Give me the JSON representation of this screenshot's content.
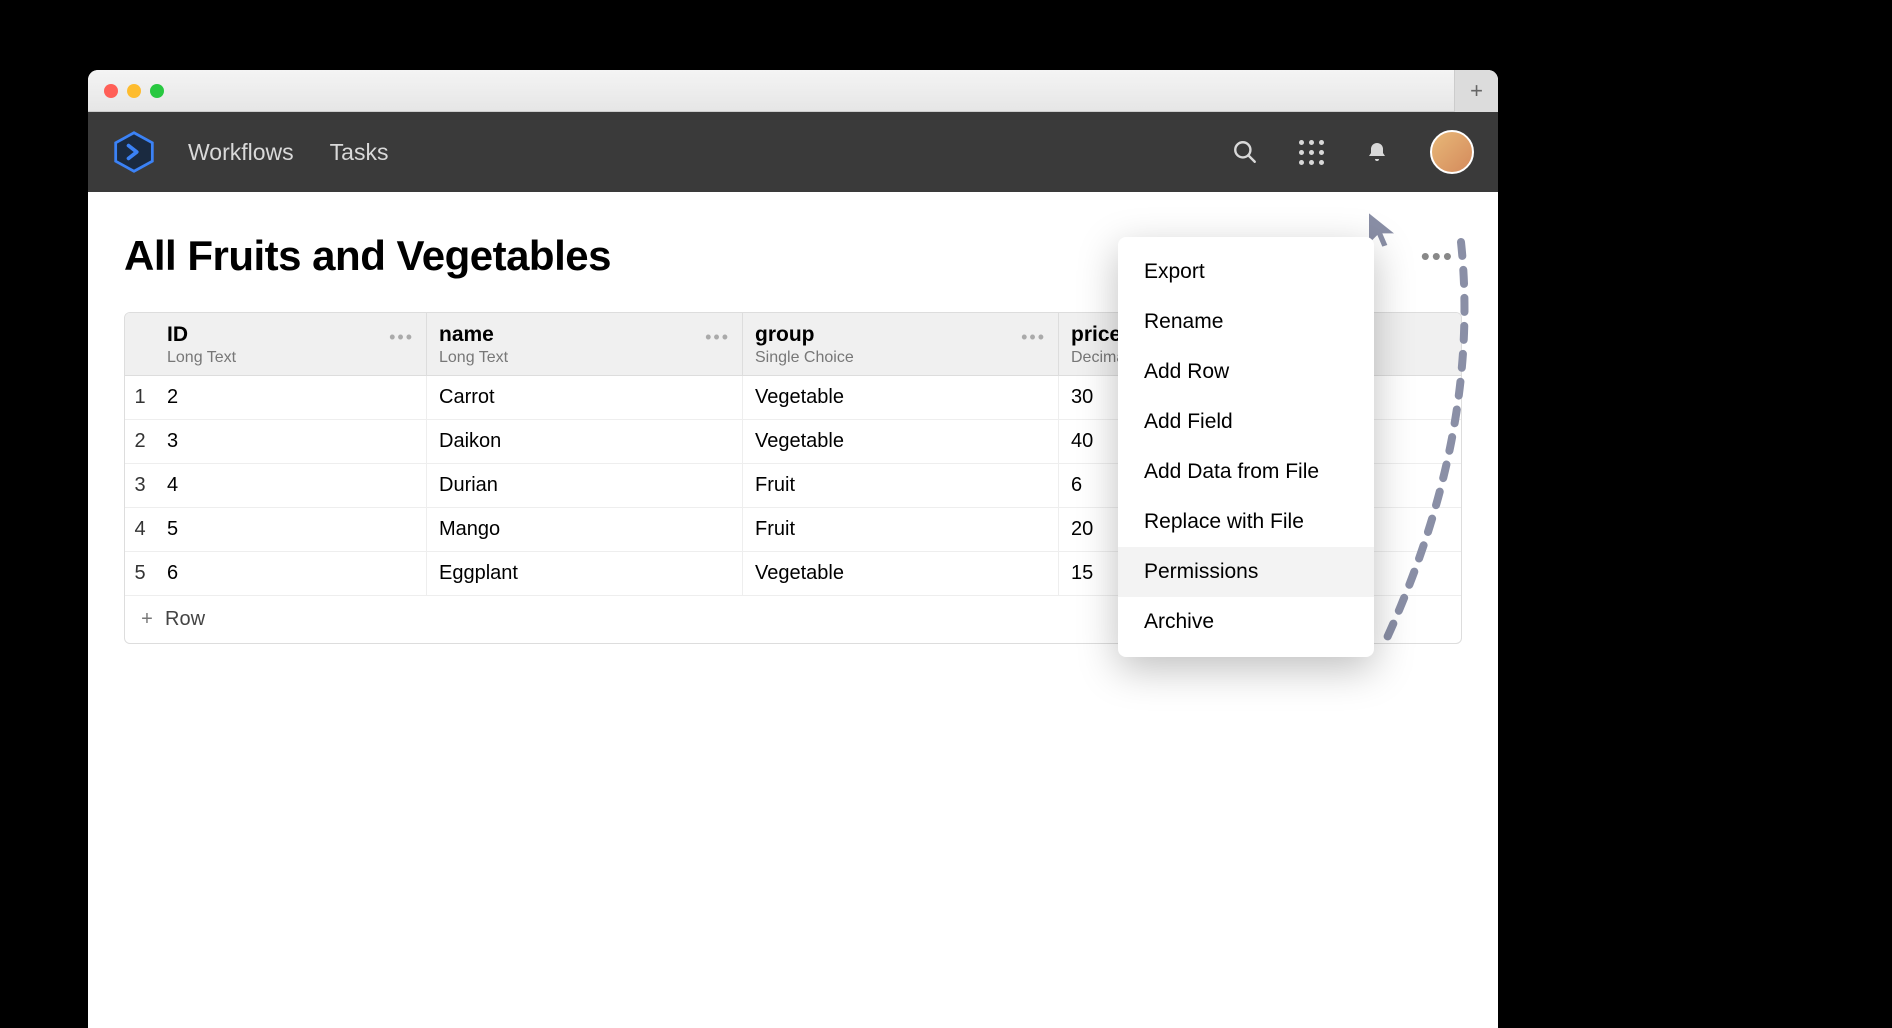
{
  "nav": {
    "links": [
      "Workflows",
      "Tasks"
    ]
  },
  "page": {
    "title": "All Fruits and Vegetables"
  },
  "table": {
    "columns": [
      {
        "name": "ID",
        "type": "Long Text"
      },
      {
        "name": "name",
        "type": "Long Text"
      },
      {
        "name": "group",
        "type": "Single Choice"
      },
      {
        "name": "price",
        "type": "Decimal"
      }
    ],
    "rows": [
      {
        "n": "1",
        "id": "2",
        "name": "Carrot",
        "group": "Vegetable",
        "price": "30"
      },
      {
        "n": "2",
        "id": "3",
        "name": "Daikon",
        "group": "Vegetable",
        "price": "40"
      },
      {
        "n": "3",
        "id": "4",
        "name": "Durian",
        "group": "Fruit",
        "price": "6"
      },
      {
        "n": "4",
        "id": "5",
        "name": "Mango",
        "group": "Fruit",
        "price": "20"
      },
      {
        "n": "5",
        "id": "6",
        "name": "Eggplant",
        "group": "Vegetable",
        "price": "15"
      }
    ],
    "add_row_label": "Row"
  },
  "menu": {
    "items": [
      "Export",
      "Rename",
      "Add Row",
      "Add Field",
      "Add Data from File",
      "Replace with File",
      "Permissions",
      "Archive"
    ],
    "hover_index": 6
  }
}
